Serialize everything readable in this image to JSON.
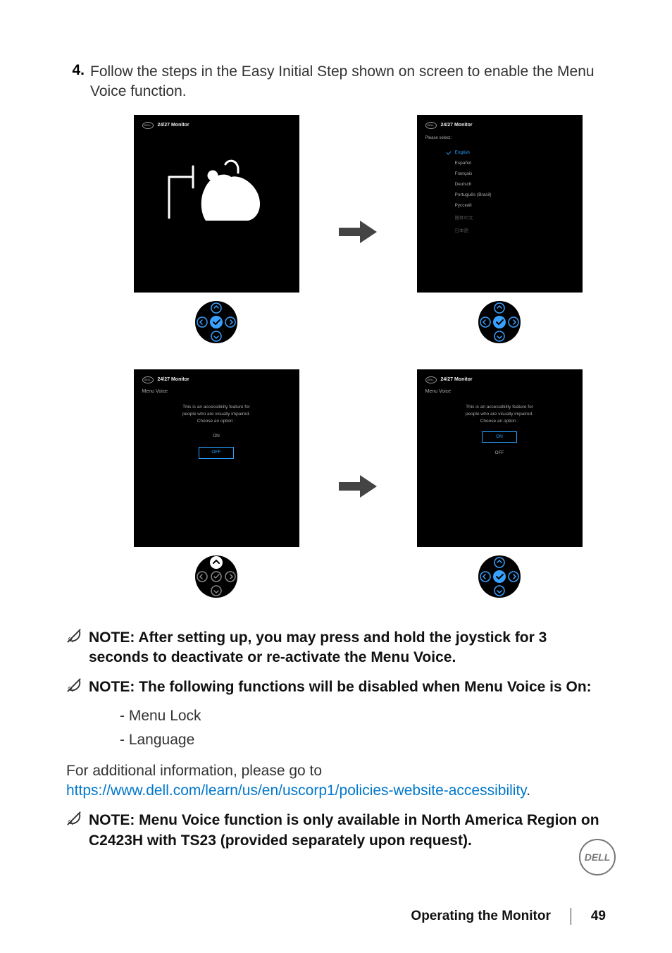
{
  "step": {
    "num": "4.",
    "text": "Follow the steps in the Easy Initial Step shown on screen to enable the Menu Voice function."
  },
  "screen": {
    "dellTiny": "DELL",
    "title": "24/27 Monitor",
    "pleaseSelect": "Please select :",
    "languages": [
      "English",
      "Español",
      "Français",
      "Deutsch",
      "Português (Brasil)",
      "Русский",
      "簡体中文",
      "日本語"
    ],
    "mvTitle": "Menu Voice",
    "mvLine1": "This is an accessibility feature for",
    "mvLine2": "people who are visually impaired.",
    "mvLine3": "Choose an option :",
    "on": "ON",
    "off": "OFF"
  },
  "notes": {
    "n1": "NOTE: After setting up, you may press and hold the joystick for 3 seconds to deactivate or re-activate the Menu Voice.",
    "n2": "NOTE: The following functions will be disabled when Menu Voice is On:",
    "b1": "- Menu Lock",
    "b2": "- Language",
    "paraPrefix": "For additional information, please go to ",
    "link": "https://www.dell.com/learn/us/en/uscorp1/policies-website-accessibility",
    "paraSuffix": ".",
    "n3": "NOTE: Menu Voice function is only available in North America Region on C2423H with TS23 (provided separately upon request)."
  },
  "footer": {
    "title": "Operating the Monitor",
    "page": "49"
  },
  "badge": "DELL"
}
